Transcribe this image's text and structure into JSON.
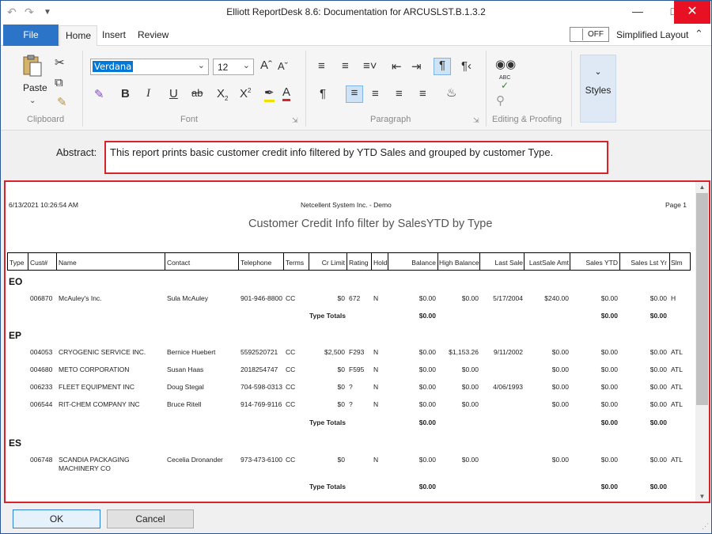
{
  "window": {
    "title": "Elliott ReportDesk 8.6: Documentation for ARCUSLST.B.1.3.2"
  },
  "tabs": {
    "file": "File",
    "home": "Home",
    "insert": "Insert",
    "review": "Review"
  },
  "toggle": {
    "state": "OFF",
    "label": "Simplified Layout"
  },
  "ribbon": {
    "clipboard": {
      "label": "Clipboard",
      "paste": "Paste"
    },
    "font": {
      "label": "Font",
      "family": "Verdana",
      "size": "12"
    },
    "paragraph": {
      "label": "Paragraph"
    },
    "editing": {
      "label": "Editing & Proofing",
      "abc": "ABC"
    },
    "styles": {
      "label": "Styles"
    }
  },
  "abstract": {
    "label": "Abstract:",
    "text": "This report prints basic customer credit info filtered by YTD Sales and grouped by customer Type."
  },
  "report": {
    "datetime": "6/13/2021 10:26:54 AM",
    "company": "Netcellent System Inc. - Demo",
    "page": "Page 1",
    "title": "Customer Credit Info filter by SalesYTD by Type",
    "columns": [
      "Type",
      "Cust#",
      "Name",
      "Contact",
      "Telephone",
      "Terms",
      "Cr Limit",
      "Rating",
      "Hold",
      "Balance",
      "High Balance",
      "Last Sale",
      "LastSale Amt",
      "Sales YTD",
      "Sales Lst Yr",
      "Slm"
    ],
    "groups": [
      {
        "type": "EO",
        "rows": [
          [
            "006870",
            "McAuley's Inc.",
            "Sula McAuley",
            "901-946-8800",
            "CC",
            "$0",
            "672",
            "N",
            "$0.00",
            "$0.00",
            "5/17/2004",
            "$240.00",
            "$0.00",
            "$0.00",
            "H"
          ]
        ],
        "totals": {
          "label": "Type Totals",
          "balance": "$0.00",
          "sales_ytd": "$0.00",
          "sales_lst_yr": "$0.00"
        }
      },
      {
        "type": "EP",
        "rows": [
          [
            "004053",
            "CRYOGENIC SERVICE INC.",
            "Bernice Huebert",
            "5592520721",
            "CC",
            "$2,500",
            "F293",
            "N",
            "$0.00",
            "$1,153.26",
            "9/11/2002",
            "$0.00",
            "$0.00",
            "$0.00",
            "ATL"
          ],
          [
            "004680",
            "METO CORPORATION",
            "Susan Haas",
            "2018254747",
            "CC",
            "$0",
            "F595",
            "N",
            "$0.00",
            "$0.00",
            "",
            "$0.00",
            "$0.00",
            "$0.00",
            "ATL"
          ],
          [
            "006233",
            "FLEET EQUIPMENT INC",
            "Doug Stegal",
            "704-598-0313",
            "CC",
            "$0",
            "?",
            "N",
            "$0.00",
            "$0.00",
            "4/06/1993",
            "$0.00",
            "$0.00",
            "$0.00",
            "ATL"
          ],
          [
            "006544",
            "RIT-CHEM COMPANY INC",
            "Bruce Ritell",
            "914-769-9116",
            "CC",
            "$0",
            "?",
            "N",
            "$0.00",
            "$0.00",
            "",
            "$0.00",
            "$0.00",
            "$0.00",
            "ATL"
          ]
        ],
        "totals": {
          "label": "Type Totals",
          "balance": "$0.00",
          "sales_ytd": "$0.00",
          "sales_lst_yr": "$0.00"
        }
      },
      {
        "type": "ES",
        "rows": [
          [
            "006748",
            "SCANDIA PACKAGING MACHINERY CO",
            "Cecelia Dronander",
            "973-473-6100",
            "CC",
            "$0",
            "",
            "N",
            "$0.00",
            "$0.00",
            "",
            "$0.00",
            "$0.00",
            "$0.00",
            "ATL"
          ]
        ],
        "totals": {
          "label": "Type Totals",
          "balance": "$0.00",
          "sales_ytd": "$0.00",
          "sales_lst_yr": "$0.00"
        }
      }
    ]
  },
  "buttons": {
    "ok": "OK",
    "cancel": "Cancel"
  },
  "colors": {
    "accent": "#2b74c7",
    "highlight_border": "#d8232a",
    "close": "#e81123"
  },
  "icons": [
    "undo-icon",
    "redo-icon",
    "customize-icon",
    "minimize-icon",
    "maximize-icon",
    "close-icon",
    "paste-icon",
    "cut-icon",
    "copy-icon",
    "format-painter-icon",
    "grow-font-icon",
    "shrink-font-icon",
    "clear-format-icon",
    "bold-icon",
    "italic-icon",
    "underline-icon",
    "strikethrough-icon",
    "subscript-icon",
    "superscript-icon",
    "highlight-icon",
    "font-color-icon",
    "bullets-icon",
    "numbering-icon",
    "multilevel-icon",
    "decrease-indent-icon",
    "increase-indent-icon",
    "show-marks-icon",
    "rtl-marks-icon",
    "pilcrow-icon",
    "align-left-icon",
    "align-center-icon",
    "align-right-icon",
    "justify-icon",
    "shading-icon",
    "find-icon",
    "spelling-icon",
    "replace-icon"
  ]
}
